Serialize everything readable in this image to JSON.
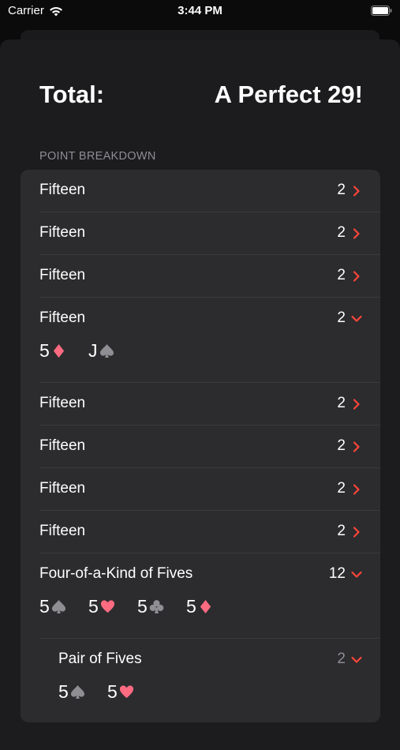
{
  "status_bar": {
    "carrier": "Carrier",
    "time": "3:44 PM",
    "icons": [
      "wifi-icon",
      "battery-icon"
    ]
  },
  "total": {
    "label": "Total:",
    "value": "A Perfect 29!"
  },
  "breakdown": {
    "header": "POINT BREAKDOWN",
    "colors": {
      "accent": "#ff453a",
      "red_suit": "#ff6b81",
      "black_suit": "#8e8e93"
    },
    "rows": [
      {
        "label": "Fifteen",
        "points": "2",
        "expanded": false
      },
      {
        "label": "Fifteen",
        "points": "2",
        "expanded": false
      },
      {
        "label": "Fifteen",
        "points": "2",
        "expanded": false
      },
      {
        "label": "Fifteen",
        "points": "2",
        "expanded": true,
        "cards": [
          {
            "rank": "5",
            "suit": "diamond"
          },
          {
            "rank": "J",
            "suit": "spade"
          }
        ]
      },
      {
        "label": "Fifteen",
        "points": "2",
        "expanded": false
      },
      {
        "label": "Fifteen",
        "points": "2",
        "expanded": false
      },
      {
        "label": "Fifteen",
        "points": "2",
        "expanded": false
      },
      {
        "label": "Fifteen",
        "points": "2",
        "expanded": false
      },
      {
        "label": "Four-of-a-Kind of Fives",
        "points": "12",
        "expanded": true,
        "cards": [
          {
            "rank": "5",
            "suit": "spade"
          },
          {
            "rank": "5",
            "suit": "heart"
          },
          {
            "rank": "5",
            "suit": "club"
          },
          {
            "rank": "5",
            "suit": "diamond"
          }
        ]
      },
      {
        "label": "Pair of Fives",
        "points": "2",
        "expanded": true,
        "sub": true,
        "cards": [
          {
            "rank": "5",
            "suit": "spade"
          },
          {
            "rank": "5",
            "suit": "heart"
          }
        ]
      }
    ]
  }
}
